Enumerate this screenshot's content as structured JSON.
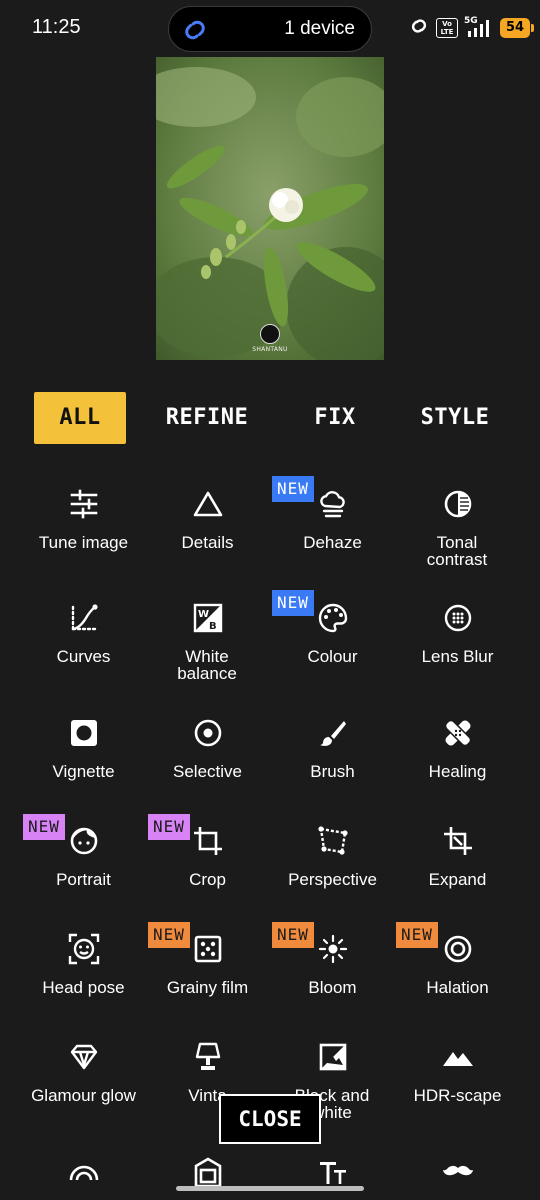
{
  "status_bar": {
    "time": "11:25",
    "island_text": "1 device",
    "volte": "Vo LTE",
    "network": "5G",
    "battery": "54"
  },
  "photo": {
    "watermark_text": "SHANTANU"
  },
  "tabs": [
    {
      "label": "ALL",
      "active": true
    },
    {
      "label": "REFINE",
      "active": false
    },
    {
      "label": "FIX",
      "active": false
    },
    {
      "label": "STYLE",
      "active": false
    }
  ],
  "tools": [
    {
      "label": "Tune image",
      "icon": "sliders-icon"
    },
    {
      "label": "Details",
      "icon": "triangle-icon"
    },
    {
      "label": "Dehaze",
      "icon": "haze-cloud-icon",
      "badge": "NEW"
    },
    {
      "label": "Tonal contrast",
      "icon": "half-circle-icon"
    },
    {
      "label": "Curves",
      "icon": "curves-icon"
    },
    {
      "label": "White balance",
      "icon": "white-balance-icon"
    },
    {
      "label": "Colour",
      "icon": "palette-icon",
      "badge": "NEW"
    },
    {
      "label": "Lens Blur",
      "icon": "lens-blur-icon"
    },
    {
      "label": "Vignette",
      "icon": "vignette-icon"
    },
    {
      "label": "Selective",
      "icon": "selective-icon"
    },
    {
      "label": "Brush",
      "icon": "brush-icon"
    },
    {
      "label": "Healing",
      "icon": "bandage-icon"
    },
    {
      "label": "Portrait",
      "icon": "face-icon",
      "badge": "NEW"
    },
    {
      "label": "Crop",
      "icon": "crop-icon",
      "badge": "NEW"
    },
    {
      "label": "Perspective",
      "icon": "perspective-icon"
    },
    {
      "label": "Expand",
      "icon": "expand-icon"
    },
    {
      "label": "Head pose",
      "icon": "head-pose-icon"
    },
    {
      "label": "Grainy film",
      "icon": "dice-icon",
      "badge": "NEW"
    },
    {
      "label": "Bloom",
      "icon": "sun-icon",
      "badge": "NEW"
    },
    {
      "label": "Halation",
      "icon": "ring-icon",
      "badge": "NEW"
    },
    {
      "label": "Glamour glow",
      "icon": "diamond-icon"
    },
    {
      "label": "Vinta",
      "icon": "lamp-icon"
    },
    {
      "label": "Black and white",
      "icon": "black-white-icon"
    },
    {
      "label": "HDR-scape",
      "icon": "mountain-icon"
    }
  ],
  "bottom_row_icons": [
    "rainbow-icon",
    "frame-icon",
    "text-icon",
    "moustache-icon"
  ],
  "colors": {
    "accent": "#f3c13a",
    "new_blue": "#3a7bf5",
    "new_purple": "#d883f5",
    "new_orange": "#f08a3c",
    "background": "#1b1b1b"
  },
  "close_label": "CLOSE"
}
